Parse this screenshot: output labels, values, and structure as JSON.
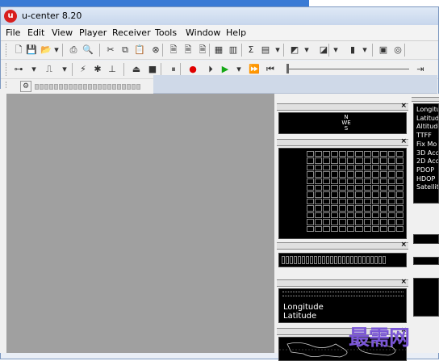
{
  "window": {
    "title": "u-center 8.20",
    "icon": "u-blox-logo-icon",
    "icon_letter": "u"
  },
  "menu": [
    "File",
    "Edit",
    "View",
    "Player",
    "Receiver",
    "Tools",
    "Window",
    "Help"
  ],
  "toolbar1": [
    {
      "name": "new-icon",
      "glyph": "🗋"
    },
    {
      "name": "save-icon",
      "glyph": "💾"
    },
    {
      "name": "open-icon",
      "glyph": "📂"
    },
    {
      "name": "dropdown-icon",
      "glyph": "▾"
    },
    {
      "name": "print-icon",
      "glyph": "⎙"
    },
    {
      "name": "print-preview-icon",
      "glyph": "🔍"
    },
    {
      "name": "cut-icon",
      "glyph": "✂"
    },
    {
      "name": "copy-icon",
      "glyph": "⧉"
    },
    {
      "name": "paste-icon",
      "glyph": "📋"
    },
    {
      "name": "export-icon",
      "glyph": "⊗"
    },
    {
      "name": "doc1-icon",
      "glyph": "🗎"
    },
    {
      "name": "doc2-icon",
      "glyph": "🗎"
    },
    {
      "name": "doc3-icon",
      "glyph": "🗎"
    },
    {
      "name": "layout1-icon",
      "glyph": "▦"
    },
    {
      "name": "layout2-icon",
      "glyph": "▥"
    },
    {
      "name": "sum-icon",
      "glyph": "Σ"
    },
    {
      "name": "table-icon",
      "glyph": "▤"
    },
    {
      "name": "dropdown-icon",
      "glyph": "▾"
    },
    {
      "name": "chart-icon",
      "glyph": "◩"
    },
    {
      "name": "dropdown-icon",
      "glyph": "▾"
    },
    {
      "name": "graph-icon",
      "glyph": "◪"
    },
    {
      "name": "dropdown-icon",
      "glyph": "▾"
    },
    {
      "name": "histogram-icon",
      "glyph": "▮"
    },
    {
      "name": "dropdown-icon",
      "glyph": "▾"
    },
    {
      "name": "monitor-icon",
      "glyph": "▣"
    },
    {
      "name": "settings-icon",
      "glyph": "◎"
    }
  ],
  "toolbar2": [
    {
      "name": "connection-icon",
      "glyph": "⊶"
    },
    {
      "name": "dropdown-icon",
      "glyph": "▾"
    },
    {
      "name": "baudrate-icon",
      "glyph": "⎍"
    },
    {
      "name": "dropdown-icon",
      "glyph": "▾"
    },
    {
      "name": "autobaud-icon",
      "glyph": "⚡"
    },
    {
      "name": "debug-icon",
      "glyph": "✱"
    },
    {
      "name": "antenna-icon",
      "glyph": "⊥"
    },
    {
      "name": "eject-icon",
      "glyph": "⏏"
    },
    {
      "name": "stop-icon",
      "glyph": "■"
    },
    {
      "name": "pause-icon",
      "glyph": "⏸"
    },
    {
      "name": "record-icon",
      "glyph": "●"
    },
    {
      "name": "step-icon",
      "glyph": "⏵"
    },
    {
      "name": "play-icon",
      "glyph": "▶"
    },
    {
      "name": "dropdown-icon",
      "glyph": "▾"
    },
    {
      "name": "fast-forward-icon",
      "glyph": "⏩"
    },
    {
      "name": "rewind-icon",
      "glyph": "⏮"
    }
  ],
  "colors": {
    "record": "#e00000",
    "play": "#16a816",
    "workspace": "#a0a0a0"
  },
  "panes": {
    "signal_cells": 144,
    "position_labels": [
      "Longitude",
      "Latitude"
    ]
  },
  "status_fields": [
    "Longitu",
    "Latitude",
    "Altitude",
    "TTFF",
    "Fix Mo",
    "3D Acc",
    "2D Acc",
    "PDOP",
    "HDOP",
    "Satellite"
  ],
  "compass": {
    "north": "N",
    "west": "W",
    "east": "E",
    "south": "S"
  },
  "watermark": "最需网"
}
